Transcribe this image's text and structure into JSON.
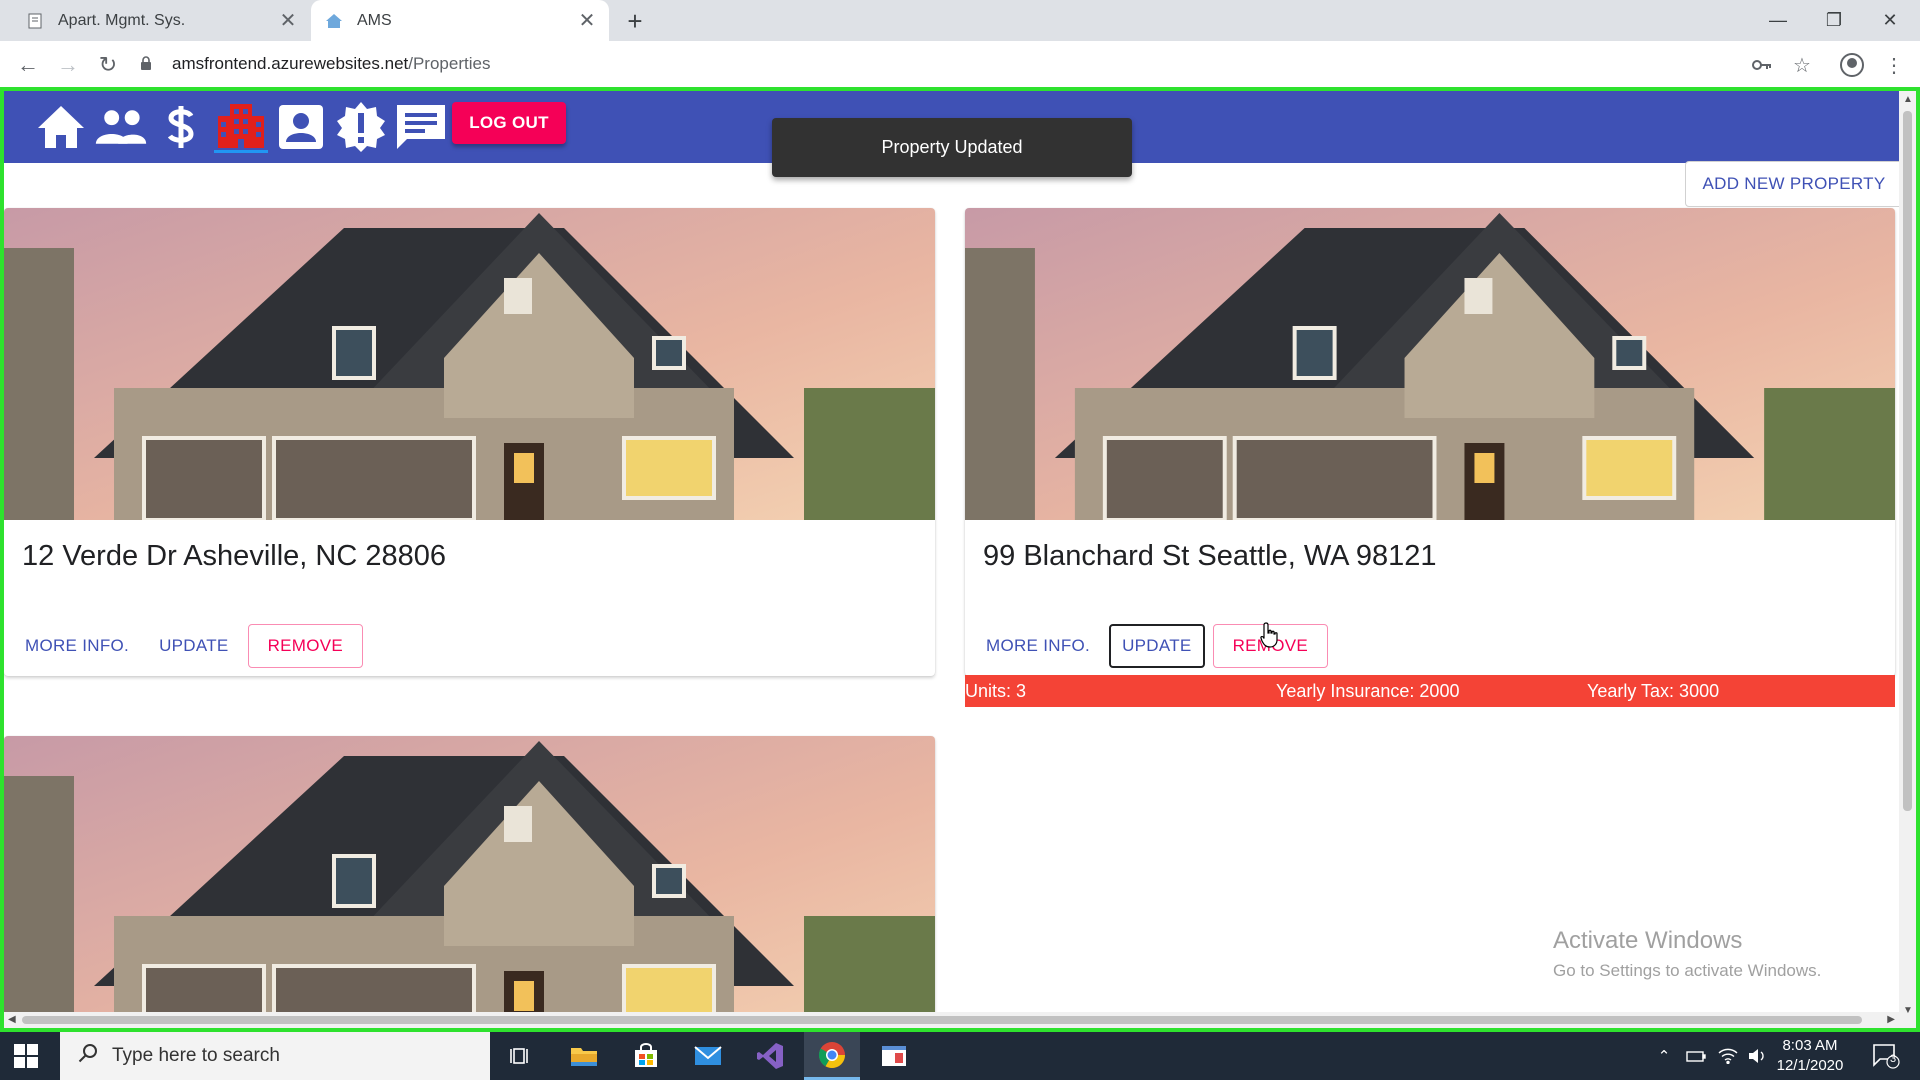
{
  "browser": {
    "tabs": [
      {
        "title": "Apart. Mgmt. Sys.",
        "icon": "document-icon"
      },
      {
        "title": "AMS",
        "icon": "house-favicon-icon"
      }
    ],
    "url_host": "amsfrontend.azurewebsites.net",
    "url_path": "/Properties"
  },
  "app": {
    "nav_icons": [
      "home-icon",
      "people-icon",
      "dollar-icon",
      "apartment-icon",
      "profile-icon",
      "alert-icon",
      "chat-icon"
    ],
    "active_nav": "apartment-icon",
    "logout_label": "LOG OUT",
    "snackbar_text": "Property Updated",
    "add_property_label": "ADD NEW PROPERTY",
    "colors": {
      "appbar": "#3f51b5",
      "accent": "#f50057",
      "info_bar": "#f44336"
    }
  },
  "properties": [
    {
      "address": "12 Verde Dr Asheville, NC 28806",
      "more_info": "MORE INFO.",
      "update": "UPDATE",
      "remove": "REMOVE"
    },
    {
      "address": "99 Blanchard St Seattle, WA 98121",
      "more_info": "MORE INFO.",
      "update": "UPDATE",
      "remove": "REMOVE",
      "details": {
        "units": "Units: 3",
        "insurance": "Yearly Insurance: 2000",
        "tax": "Yearly Tax: 3000"
      }
    }
  ],
  "watermark": {
    "title": "Activate Windows",
    "subtitle": "Go to Settings to activate Windows."
  },
  "taskbar": {
    "search_placeholder": "Type here to search",
    "time": "8:03 AM",
    "date": "12/1/2020",
    "notification_count": "3"
  }
}
